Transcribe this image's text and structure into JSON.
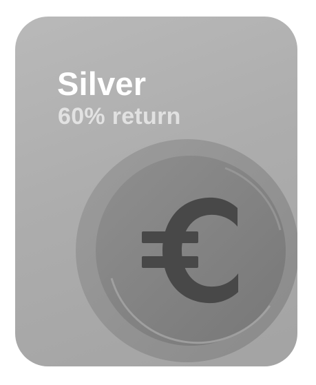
{
  "card": {
    "title": "Silver",
    "subtitle": "60% return",
    "icon": "euro-coin-icon",
    "colors": {
      "card_background": "#adadad",
      "coin": "#8a8a8a",
      "symbol": "#4a4a4a",
      "text": "#ffffff"
    }
  }
}
